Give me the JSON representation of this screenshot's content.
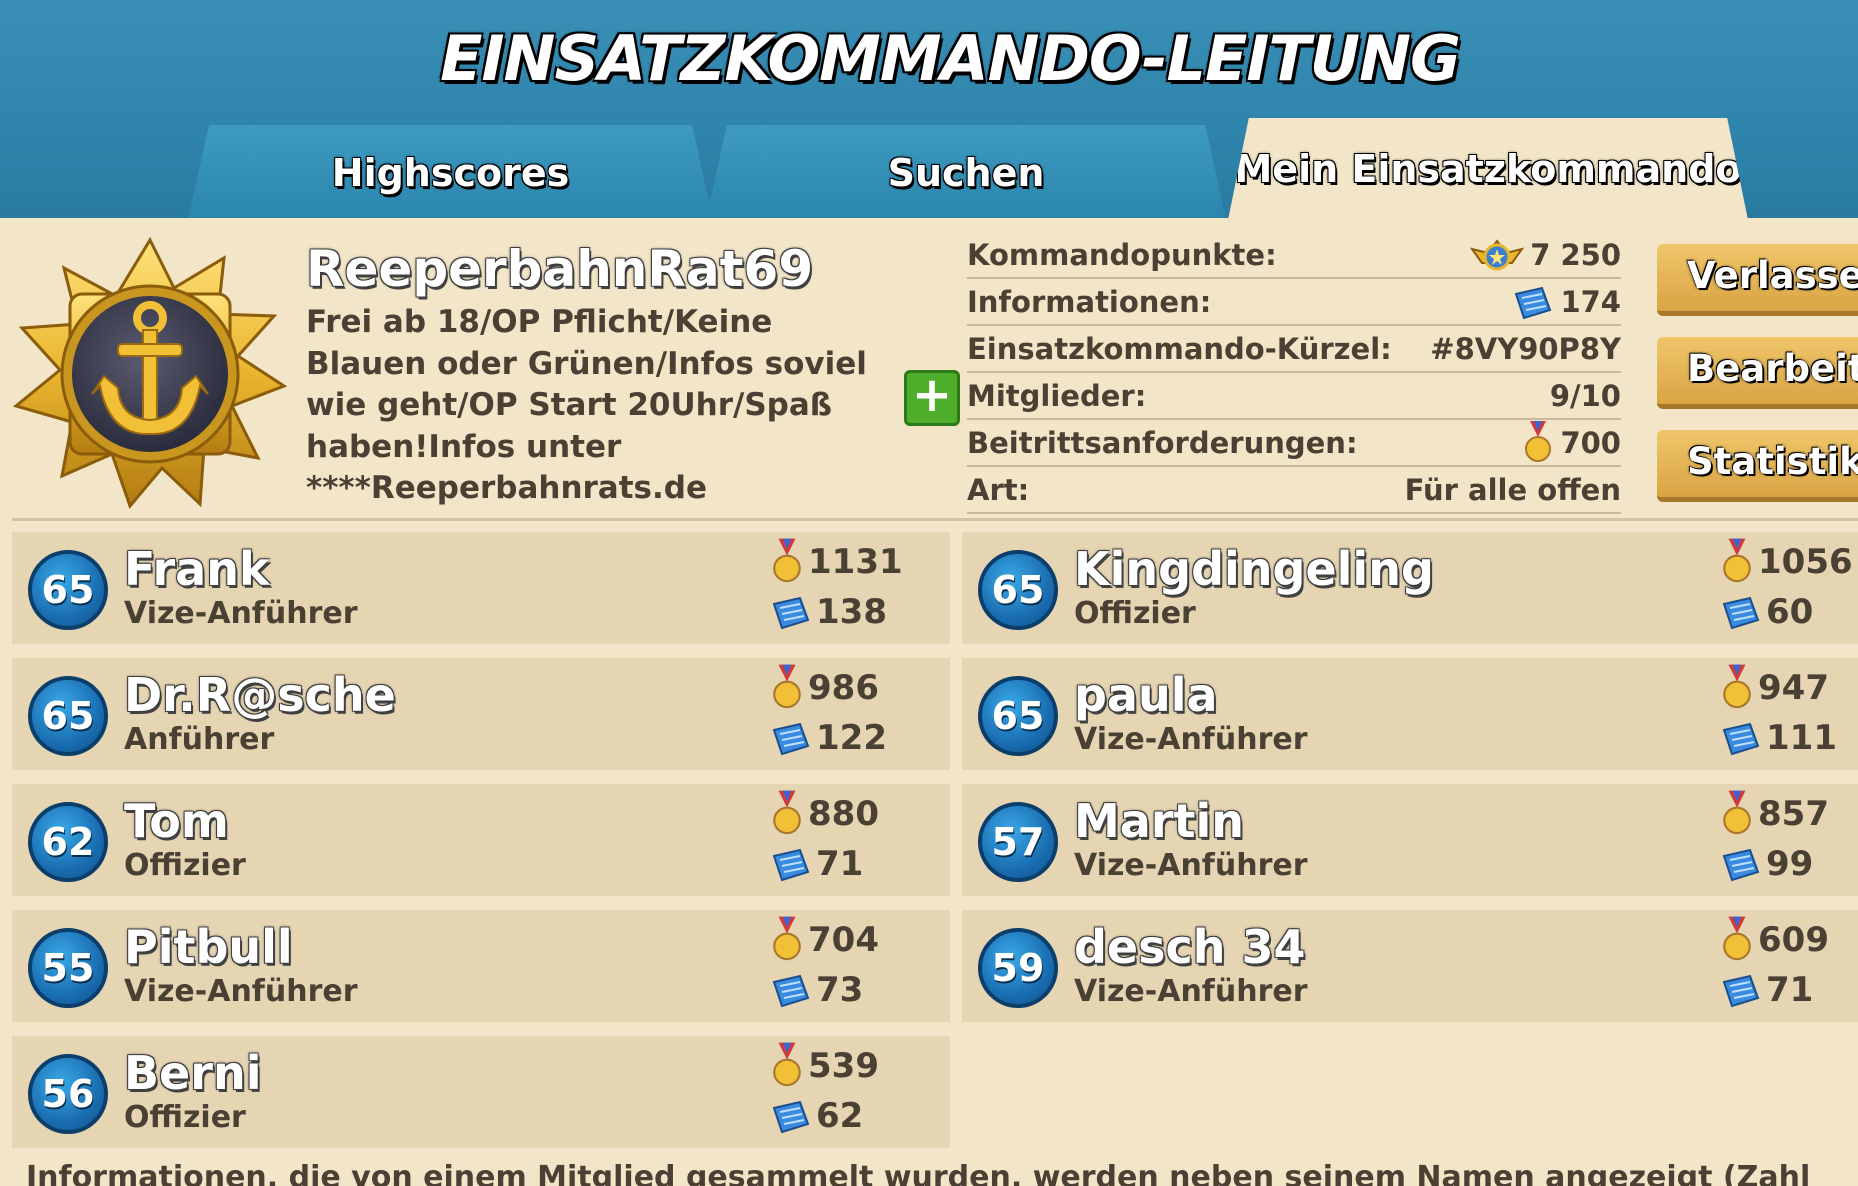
{
  "header": {
    "title": "EINSATZKOMMANDO-LEITUNG"
  },
  "tabs": [
    {
      "label": "Highscores",
      "active": false
    },
    {
      "label": "Suchen",
      "active": false
    },
    {
      "label": "Mein Einsatzkommando",
      "active": true
    }
  ],
  "clan": {
    "name": "ReeperbahnRat69",
    "description_lines": [
      "Frei ab 18/OP Pflicht/Keine",
      "Blauen oder Grünen/Infos soviel",
      "wie geht/OP Start 20Uhr/Spaß",
      "haben!Infos unter",
      "****Reeperbahnrats.de"
    ],
    "emblem_icon": "anchor-icon"
  },
  "info": [
    {
      "label": "Kommandopunkte:",
      "value": "7 250",
      "icon": "command-points-icon"
    },
    {
      "label": "Informationen:",
      "value": "174",
      "icon": "intel-icon"
    },
    {
      "label": "Einsatzkommando-Kürzel:",
      "value": "#8VY90P8Y",
      "icon": ""
    },
    {
      "label": "Mitglieder:",
      "value": "9/10",
      "icon": ""
    },
    {
      "label": "Beitrittsanforderungen:",
      "value": "700",
      "icon": "medal-icon"
    },
    {
      "label": "Art:",
      "value": "Für alle offen",
      "icon": ""
    }
  ],
  "buttons": {
    "leave": "Verlassen",
    "edit": "Bearbeiten",
    "stats": "Statistik"
  },
  "members": [
    {
      "level": "65",
      "name": "Frank",
      "role": "Vize-Anführer",
      "medals": "1131",
      "intel": "138"
    },
    {
      "level": "65",
      "name": "Kingdingeling",
      "role": "Offizier",
      "medals": "1056",
      "intel": "60"
    },
    {
      "level": "65",
      "name": "Dr.R@sche",
      "role": "Anführer",
      "medals": "986",
      "intel": "122"
    },
    {
      "level": "65",
      "name": "paula",
      "role": "Vize-Anführer",
      "medals": "947",
      "intel": "111"
    },
    {
      "level": "62",
      "name": "Tom",
      "role": "Offizier",
      "medals": "880",
      "intel": "71"
    },
    {
      "level": "57",
      "name": "Martin",
      "role": "Vize-Anführer",
      "medals": "857",
      "intel": "99"
    },
    {
      "level": "55",
      "name": "Pitbull",
      "role": "Vize-Anführer",
      "medals": "704",
      "intel": "73"
    },
    {
      "level": "59",
      "name": "desch 34",
      "role": "Vize-Anführer",
      "medals": "609",
      "intel": "71"
    },
    {
      "level": "56",
      "name": "Berni",
      "role": "Offizier",
      "medals": "539",
      "intel": "62"
    }
  ],
  "footer": {
    "text": "Informationen, die von einem Mitglied gesammelt wurden, werden neben seinem Namen angezeigt (Zahl"
  },
  "colors": {
    "panel": "#f3e5c7",
    "tab_blue": "#2f84ab",
    "text_brown": "#4a4034",
    "level_blue": "#1a6eb2",
    "button_gold": "#e0ad4f"
  }
}
